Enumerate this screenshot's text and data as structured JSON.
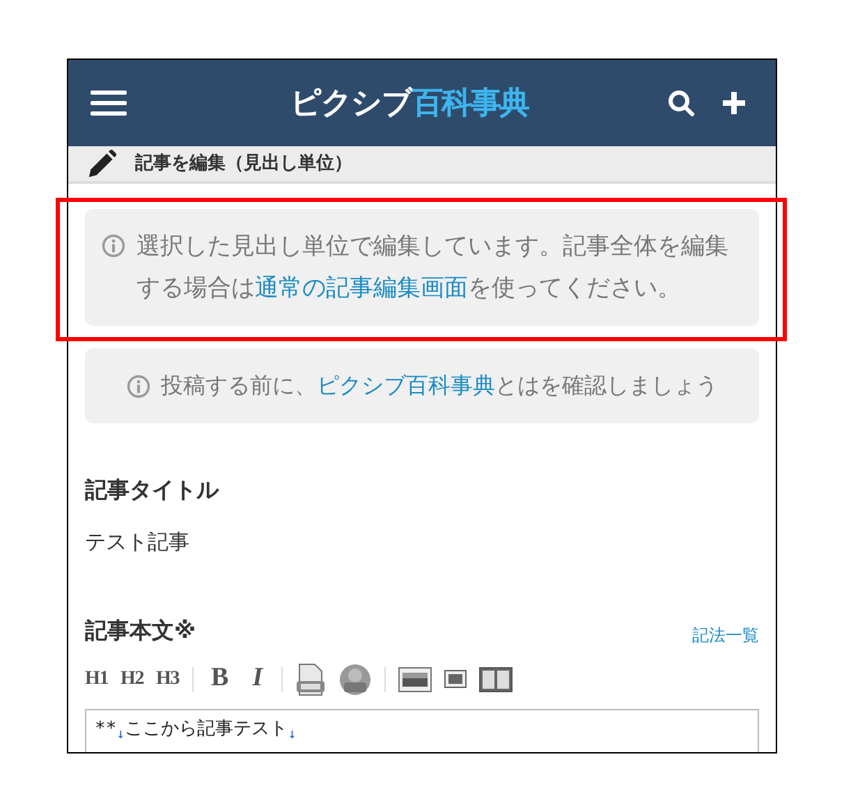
{
  "header": {
    "logo_main": "ピクシブ",
    "logo_accent": "百科事典"
  },
  "subheader": {
    "title": "記事を編集（見出し単位）"
  },
  "notices": [
    {
      "highlighted": true,
      "parts": [
        {
          "text": "選択した見出し単位で編集しています。記事全体を編集する場合は",
          "link": false
        },
        {
          "text": "通常の記事編集画面",
          "link": true
        },
        {
          "text": "を使ってください。",
          "link": false
        }
      ]
    },
    {
      "highlighted": false,
      "parts": [
        {
          "text": "投稿する前に、",
          "link": false
        },
        {
          "text": "ピクシブ百科事典",
          "link": true
        },
        {
          "text": "とはを確認しましょう",
          "link": false
        }
      ]
    }
  ],
  "title_field": {
    "label": "記事タイトル",
    "value": "テスト記事"
  },
  "body_field": {
    "label": "記事本文※",
    "help_link": "記法一覧",
    "toolbar": [
      {
        "kind": "text",
        "label": "H1"
      },
      {
        "kind": "text",
        "label": "H2"
      },
      {
        "kind": "text",
        "label": "H3"
      },
      {
        "kind": "separator"
      },
      {
        "kind": "bold",
        "label": "B"
      },
      {
        "kind": "italic",
        "label": "I"
      },
      {
        "kind": "separator"
      },
      {
        "kind": "file"
      },
      {
        "kind": "avatar"
      },
      {
        "kind": "separator"
      },
      {
        "kind": "image"
      },
      {
        "kind": "small-image"
      },
      {
        "kind": "book"
      }
    ],
    "lines": [
      {
        "text": "**",
        "newline_mark": "↓"
      },
      {
        "text": "ここから記事テスト",
        "newline_mark": "↓"
      }
    ]
  }
}
